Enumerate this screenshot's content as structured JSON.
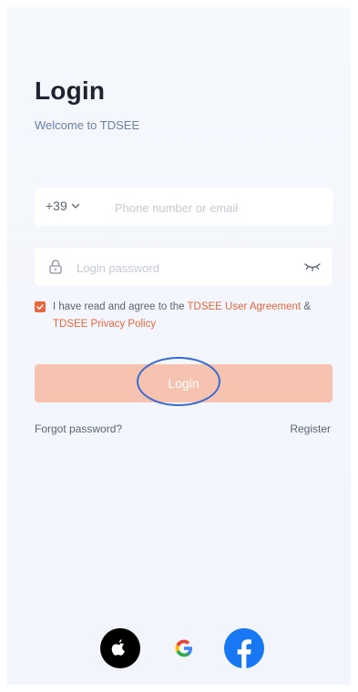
{
  "header": {
    "title": "Login",
    "subtitle": "Welcome to TDSEE"
  },
  "phone_field": {
    "country_code": "+39",
    "placeholder": "Phone number or email",
    "value": ""
  },
  "password_field": {
    "placeholder": "Login password",
    "value": ""
  },
  "agreement": {
    "checked": true,
    "text_prefix": "I have read and agree to the ",
    "user_agreement_link": "TDSEE User Agreement",
    "conjunction": " & ",
    "privacy_policy_link": "TDSEE Privacy Policy"
  },
  "login_button": {
    "label": "Login"
  },
  "links": {
    "forgot_password": "Forgot password?",
    "register": "Register"
  },
  "social": {
    "icons": [
      "apple-icon",
      "google-icon",
      "facebook-icon"
    ]
  },
  "colors": {
    "accent": "#e9663d",
    "login_button_bg": "#f5c3b0",
    "facebook_blue": "#1877f2",
    "highlight_ring": "#3a6bd0"
  }
}
